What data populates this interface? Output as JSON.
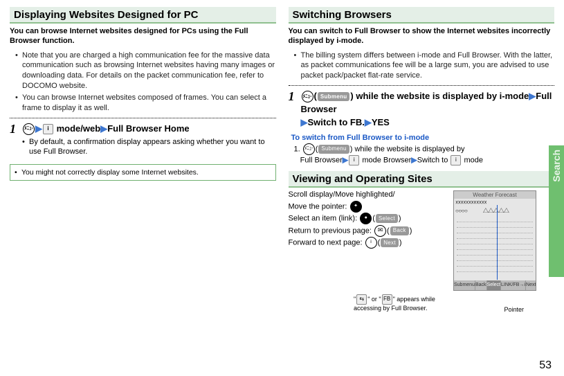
{
  "pageNumber": "53",
  "tabLabel": "Search",
  "left": {
    "heading": "Displaying Websites Designed for PC",
    "lead": "You can browse Internet websites designed for PCs using the Full Browser function.",
    "bullets": [
      "Note that you are charged a high communication fee for the massive data communication such as browsing Internet websites having many images or downloading data. For details on the packet communication fee, refer to DOCOMO website.",
      "You can browse Internet websites composed of frames. You can select a frame to display it as well."
    ],
    "step": {
      "num": "1",
      "menuLabel": "ﾒﾆｭ-",
      "seg1": " mode/web",
      "seg2": "Full Browser Home"
    },
    "stepNote": "By default, a confirmation display appears asking whether you want to use Full Browser.",
    "framedNote": "You might not correctly display some Internet websites."
  },
  "rightTop": {
    "heading": "Switching Browsers",
    "lead": "You can switch to Full Browser to show the Internet websites incorrectly displayed by i-mode.",
    "bullet": "The billing system differs between i-mode and Full Browser. With the latter, as packet communications fee will be a large sum, you are advised to use packet pack/packet flat-rate service.",
    "step": {
      "num": "1",
      "menuLabel": "ﾒﾆｭ-",
      "submenuPill": "Submenu",
      "line1a": "(",
      "line1b": ") while the website is displayed by i-mode",
      "line1c": "Full Browser",
      "line2a": "Switch to FB.",
      "line2b": "YES"
    },
    "sub": {
      "title": "To switch from Full Browser to i-mode",
      "num": "1. ",
      "menuLabel": "ﾒﾆｭ-",
      "submenuPill": "Submenu",
      "txt1": ") while the website is displayed by",
      "txt2a": "Full Browser",
      "txt2b": " mode Browser",
      "txt2c": "Switch to ",
      "txt2d": " mode"
    }
  },
  "rightBottom": {
    "heading": "Viewing and Operating Sites",
    "l1": "Scroll display/Move highlighted/",
    "l2a": "Move the pointer: ",
    "l3a": "Select an item (link): ",
    "l3pill": "Select",
    "l4a": "Return to previous page: ",
    "l4pill": "Back",
    "l5a": "Forward to next page: ",
    "l5pill": "Next",
    "capIcons": "\"   \" or \"   \" appears while accessing by Full Browser.",
    "capPointer": "Pointer",
    "shot": {
      "title": "Weather Forecast",
      "symbols1": "☓☓☓☓☓☓☓☓☓☓☓☓",
      "symbols2": "○○○○　　　△△△△△",
      "btnSubmenu": "Submenu",
      "btnBack": "Back",
      "btnSelect": "Select",
      "btnLink": "LINK/FB→i",
      "btnNext": "Next"
    }
  }
}
